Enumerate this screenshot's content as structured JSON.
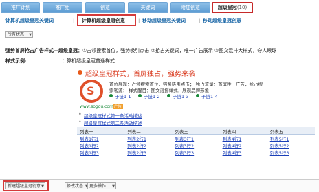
{
  "top_tabs": [
    {
      "label": "推广计划"
    },
    {
      "label": "推广组"
    },
    {
      "label": "创意"
    },
    {
      "label": "关键词"
    },
    {
      "label": "附加创意"
    },
    {
      "label": "超级皇冠",
      "count": "(10)"
    }
  ],
  "sub_tabs": [
    {
      "label": "计算机超级皇冠关键词"
    },
    {
      "label": "计算机超级皇冠创意"
    },
    {
      "label": "移动超级皇冠关键词"
    },
    {
      "label": "移动超级皇冠创意"
    }
  ],
  "status_filter": {
    "value": "所有状态"
  },
  "description": {
    "title": "强势首屏抢占广告样式—超级皇冠：",
    "features": "①占领搜索首位，强势吸引点击 ②抢占关键词，唯一广告展示 ③图文混排大样式，夺人眼球"
  },
  "sample": {
    "label": "样式示例:",
    "name": "计算机超级皇冠普通样式",
    "headline": "超级皇冠样式，首屏独占，强势来袭",
    "desc_line1": "首位展现：占领搜索首位，强势吸引点击；  独占流量：首屏唯一广告，抢占搜",
    "desc_line2": "索客源；  样式醒目：图文混排样式，展现品牌形象",
    "sublinks": [
      "子链1-1",
      "子链1-2",
      "子链1-3",
      "子链1-4"
    ],
    "url": "www.sogou.com",
    "badge": "广告",
    "activities": [
      "超级皇冠样式第一条活动描述",
      "超级皇冠样式第二条活动描述"
    ],
    "table_headers": [
      "列表一",
      "列表二",
      "列表三",
      "列表四",
      "列表五"
    ],
    "table_rows": [
      [
        "列表1行1",
        "列表2行1",
        "列表3行1",
        "列表4行1",
        "列表5行1"
      ],
      [
        "列表1行2",
        "列表2行2",
        "列表3行2",
        "列表4行2",
        "列表5行2"
      ],
      [
        "列表1行3",
        "列表2行3",
        "列表3行3",
        "列表4行3",
        "列表5行3"
      ]
    ]
  },
  "bottom": {
    "new_button": "新建超级皇冠创意",
    "modify_status": "修改状态",
    "more_ops": "更多操作"
  },
  "colors": {
    "accent": "#2d86c9",
    "highlight": "#d43a3a",
    "link": "#1a3fb8"
  }
}
